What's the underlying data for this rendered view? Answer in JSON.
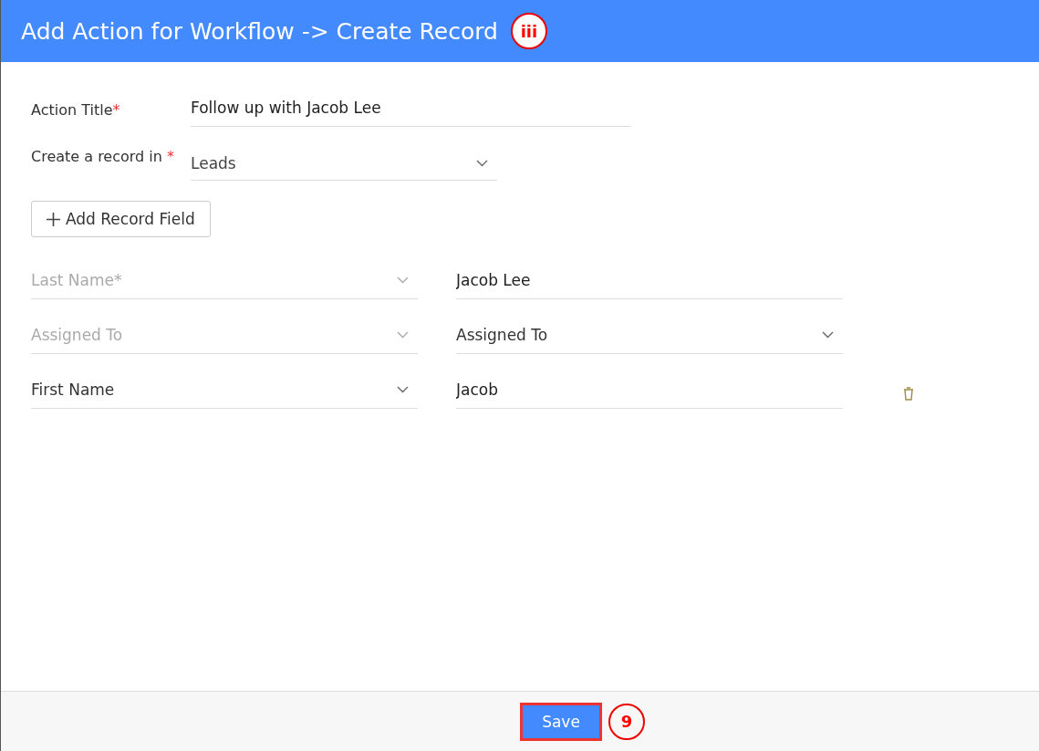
{
  "header": {
    "title": "Add Action for Workflow -> Create Record",
    "callout": "iii"
  },
  "action_title": {
    "label": "Action Title",
    "required_mark": "*",
    "value": "Follow up with Jacob Lee"
  },
  "record_module": {
    "label": "Create a record in",
    "required_mark": "*",
    "value": "Leads"
  },
  "add_field_button": {
    "label": "Add Record Field"
  },
  "field_rows": [
    {
      "field": "Last Name*",
      "disabled": true,
      "kind": "text",
      "value": "Jacob Lee",
      "removable": false
    },
    {
      "field": "Assigned To",
      "disabled": true,
      "kind": "dropdown",
      "value": "Assigned To",
      "removable": false
    },
    {
      "field": "First Name",
      "disabled": false,
      "kind": "text",
      "value": "Jacob",
      "removable": true
    }
  ],
  "footer": {
    "save_button": "Save",
    "highlighted": true,
    "callout": "9"
  }
}
